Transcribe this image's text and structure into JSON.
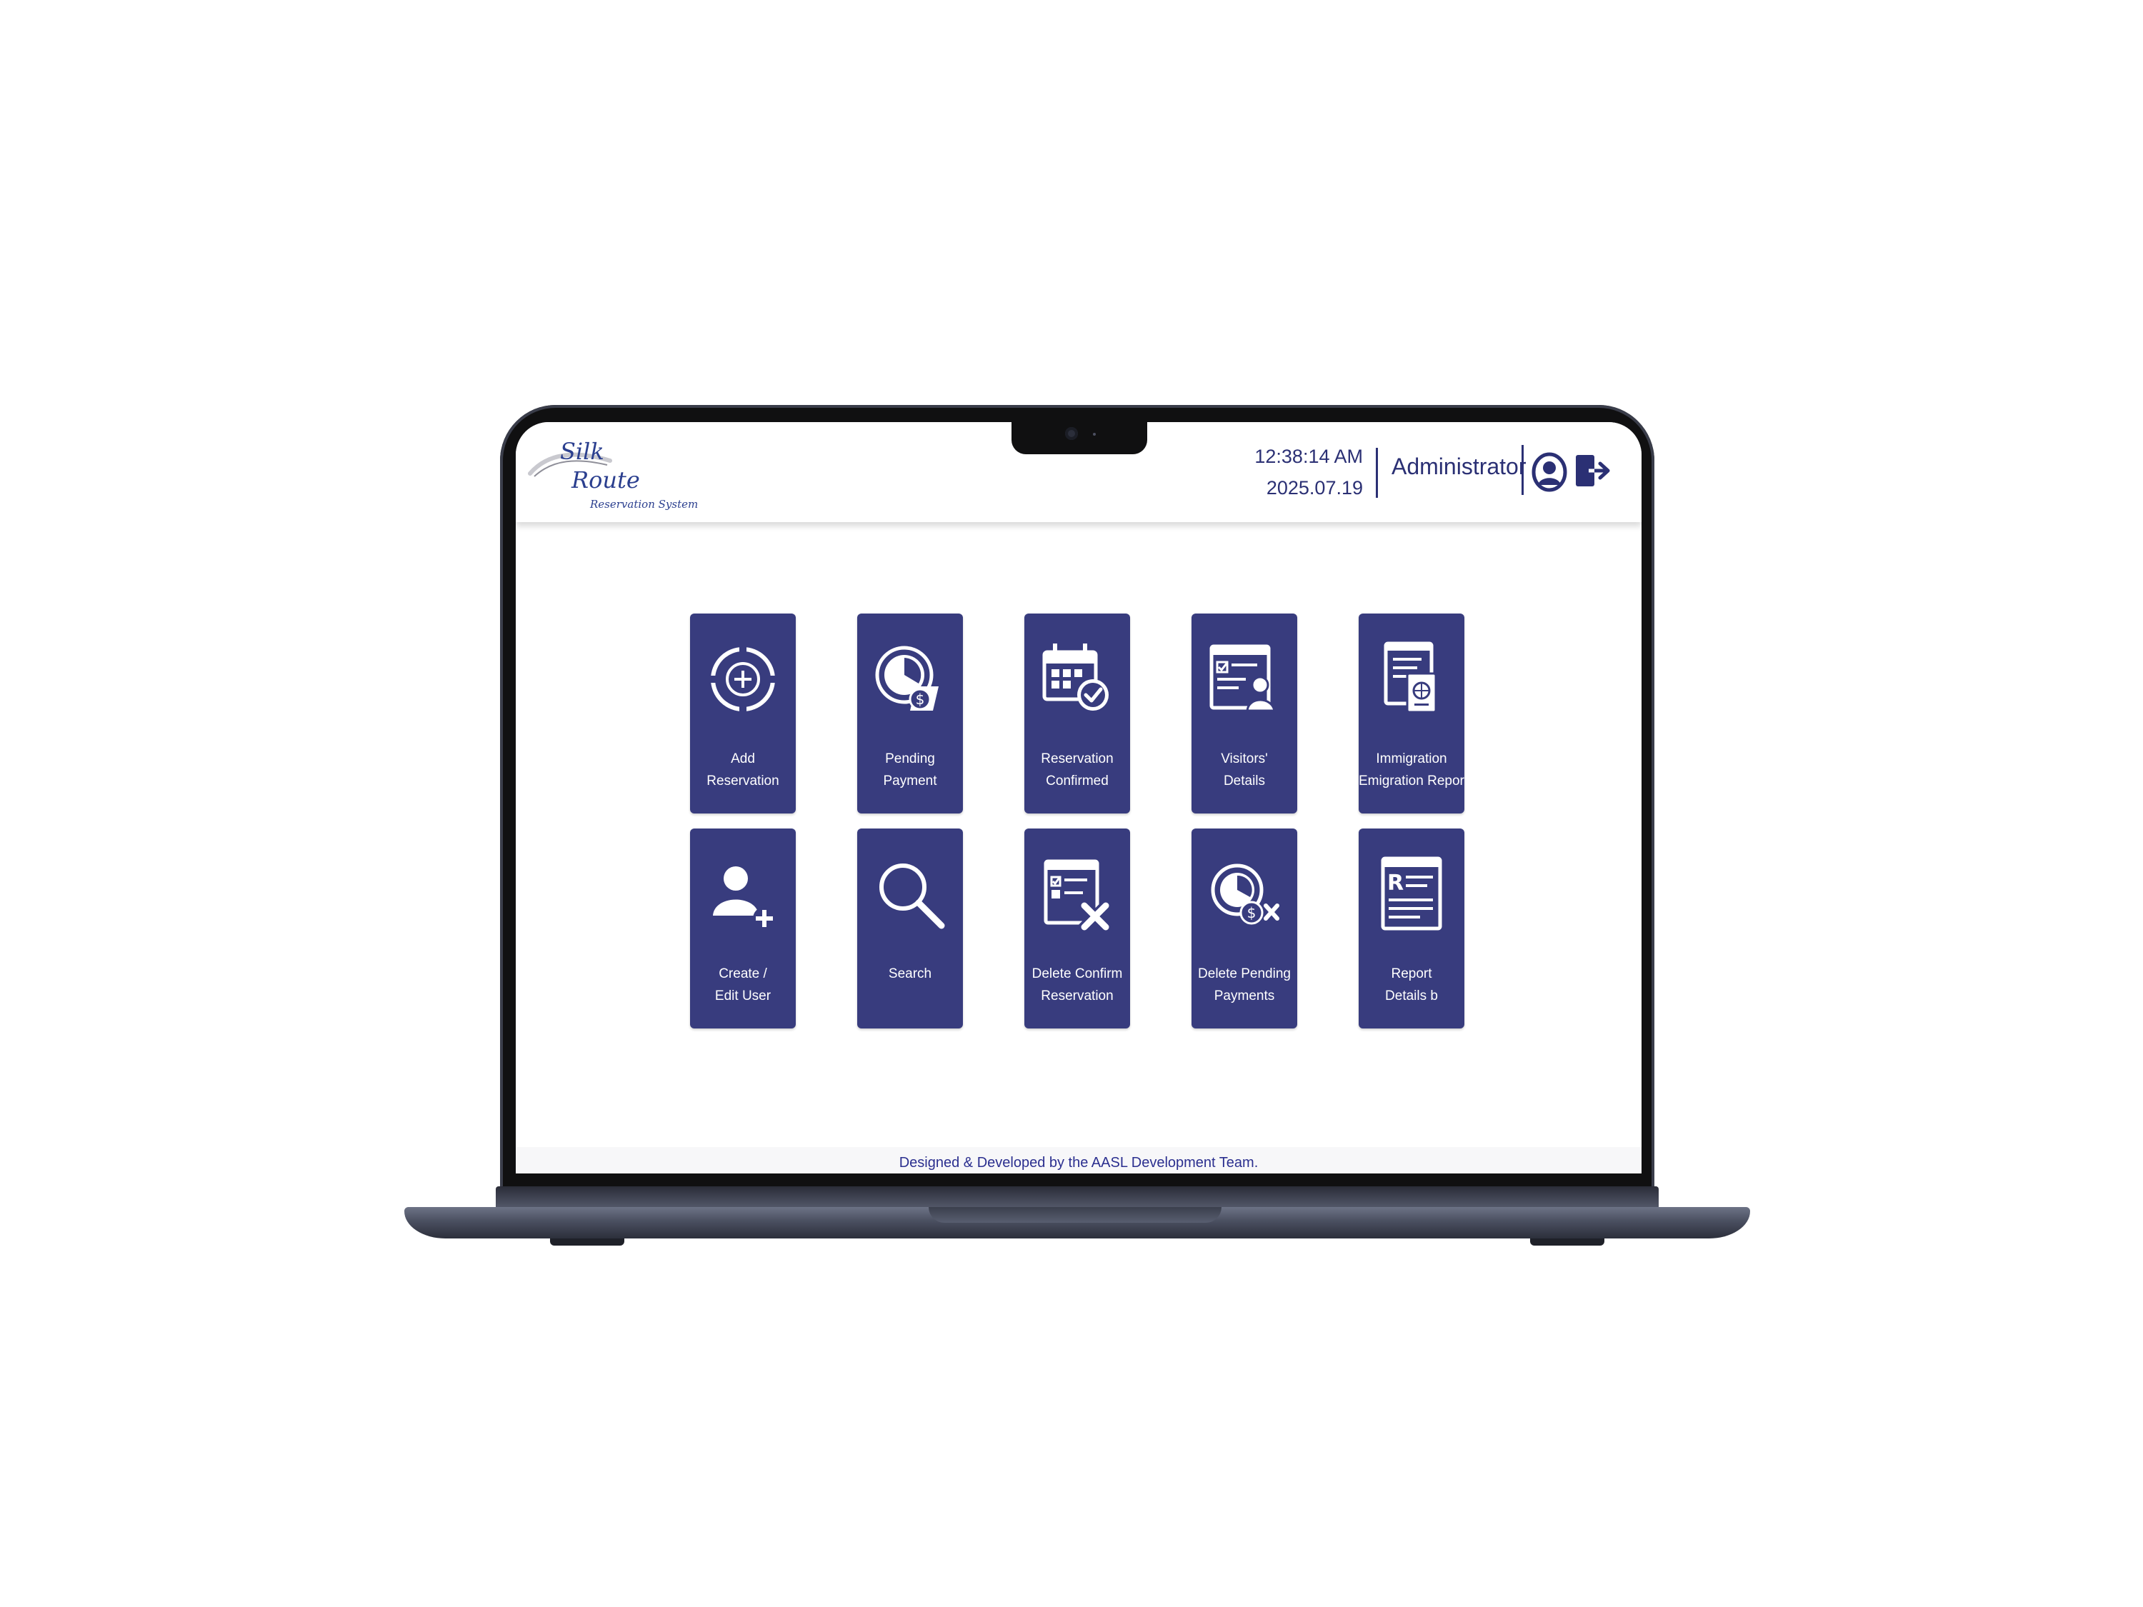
{
  "app": {
    "logo": {
      "line1": "Silk",
      "line2": "Route",
      "subtitle": "Reservation System"
    },
    "header": {
      "time": "12:38:14 AM",
      "date": "2025.07.19",
      "user_role": "Administrator"
    },
    "icons": {
      "user": "user-circle-icon",
      "logout": "logout-icon"
    },
    "colors": {
      "tile_bg": "#383c7e",
      "header_text": "#2b3074",
      "footer_text": "#2b2f8f"
    },
    "tiles": [
      {
        "icon": "add-circle-icon",
        "line1": "Add",
        "line2": "Reservation"
      },
      {
        "icon": "pending-payment-icon",
        "line1": "Pending",
        "line2": "Payment"
      },
      {
        "icon": "calendar-check-icon",
        "line1": "Reservation",
        "line2": "Confirmed"
      },
      {
        "icon": "visitor-details-icon",
        "line1": "Visitors'",
        "line2": "Details"
      },
      {
        "icon": "passport-report-icon",
        "line1": "Immigration",
        "line2": "Emigration Report"
      },
      {
        "icon": "add-user-icon",
        "line1": "Create /",
        "line2": "Edit User"
      },
      {
        "icon": "search-icon",
        "line1": "Search",
        "line2": ""
      },
      {
        "icon": "delete-reservation-icon",
        "line1": "Delete Confirm",
        "line2": "Reservation"
      },
      {
        "icon": "delete-payment-icon",
        "line1": "Delete Pending",
        "line2": "Payments"
      },
      {
        "icon": "report-details-icon",
        "line1": "Report",
        "line2": "Details b"
      }
    ],
    "footer": "Designed & Developed by the AASL Development Team."
  }
}
